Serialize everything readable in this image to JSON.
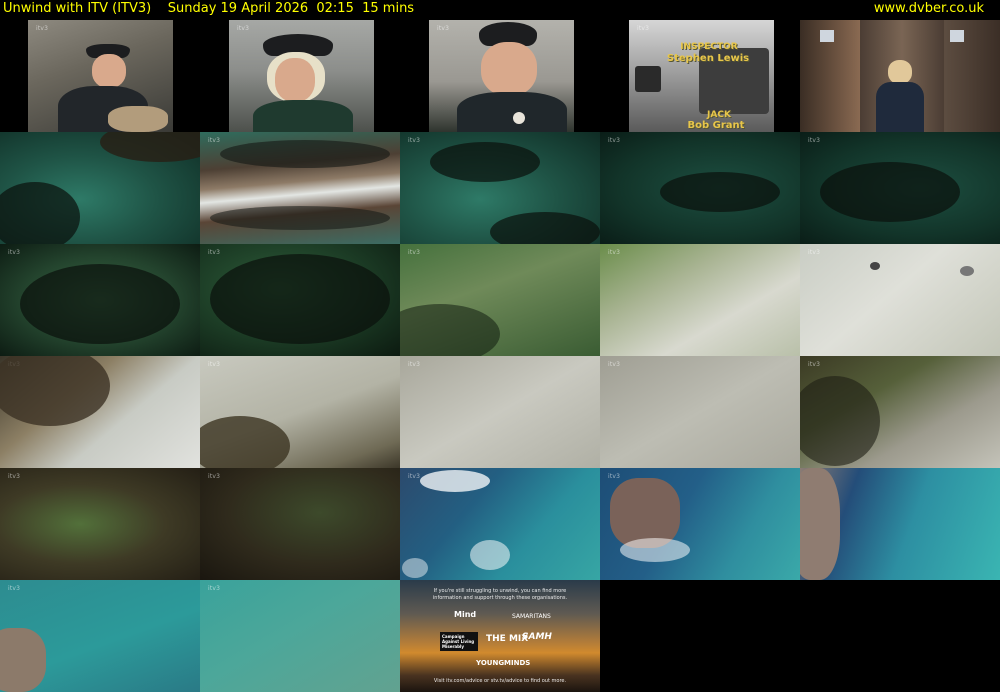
{
  "header": {
    "title": "Unwind with ITV (ITV3)    Sunday 19 April 2026  02:15  15 mins",
    "site": "www.dvber.co.uk",
    "color": "#ffff00"
  },
  "channel_logo": "itv3",
  "row1": {
    "credit_one_role": "INSPECTOR",
    "credit_one_name": "Stephen Lewis",
    "credit_two_role": "JACK",
    "credit_two_name": "Bob Grant"
  },
  "helpline_card": {
    "intro": "If you're still struggling to unwind, you can find more information and support through these organisations.",
    "org_mind": "Mind",
    "org_samaritans": "SAMARITANS",
    "org_calm": "Campaign Against Living Miserably",
    "org_mix": "THE MIX",
    "org_samh": "SAMH",
    "org_youngminds": "YOUNGMINDS",
    "footer": "Visit itv.com/advice or stv.tv/advice to find out more."
  }
}
